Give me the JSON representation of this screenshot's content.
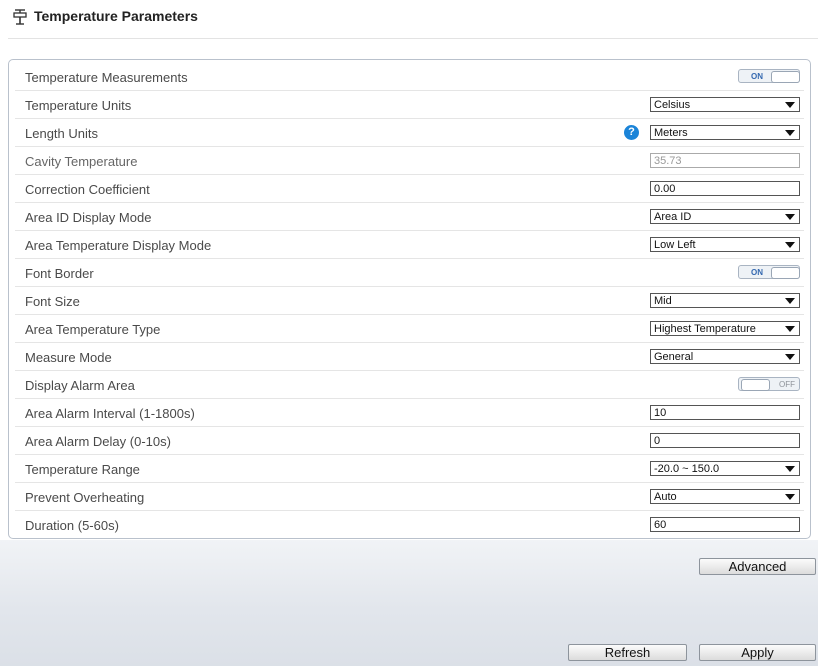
{
  "header": {
    "title": "Temperature Parameters",
    "icon": "thermometer-icon"
  },
  "rows": [
    {
      "label": "Temperature Measurements",
      "type": "toggle",
      "state": "ON"
    },
    {
      "label": "Temperature Units",
      "type": "select",
      "value": "Celsius"
    },
    {
      "label": "Length Units",
      "type": "select",
      "value": "Meters",
      "help": "?"
    },
    {
      "label": "Cavity Temperature",
      "type": "input",
      "value": "35.73",
      "disabled": true
    },
    {
      "label": "Correction Coefficient",
      "type": "input",
      "value": "0.00"
    },
    {
      "label": "Area ID Display Mode",
      "type": "select",
      "value": "Area ID"
    },
    {
      "label": "Area Temperature Display Mode",
      "type": "select",
      "value": "Low Left"
    },
    {
      "label": "Font Border",
      "type": "toggle",
      "state": "ON"
    },
    {
      "label": "Font Size",
      "type": "select",
      "value": "Mid"
    },
    {
      "label": "Area Temperature Type",
      "type": "select",
      "value": "Highest Temperature"
    },
    {
      "label": "Measure Mode",
      "type": "select",
      "value": "General"
    },
    {
      "label": "Display Alarm Area",
      "type": "toggle",
      "state": "OFF"
    },
    {
      "label": "Area Alarm Interval (1-1800s)",
      "type": "input",
      "value": "10"
    },
    {
      "label": "Area Alarm Delay (0-10s)",
      "type": "input",
      "value": "0"
    },
    {
      "label": "Temperature Range",
      "type": "select",
      "value": "-20.0 ~ 150.0"
    },
    {
      "label": "Prevent Overheating",
      "type": "select",
      "value": "Auto"
    },
    {
      "label": "Duration (5-60s)",
      "type": "input",
      "value": "60"
    }
  ],
  "buttons": {
    "advanced": "Advanced",
    "refresh": "Refresh",
    "apply": "Apply"
  },
  "colors": {
    "help_icon": "#1b84d8",
    "toggle_on_text": "#3468b0",
    "panel_border": "#b9c1cc"
  }
}
